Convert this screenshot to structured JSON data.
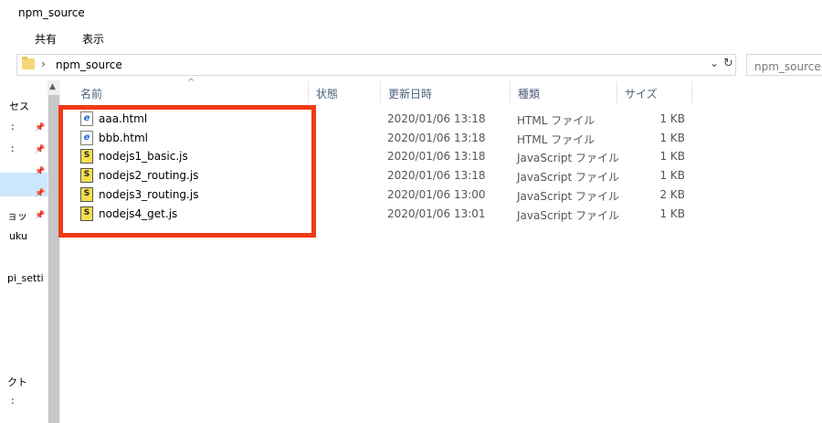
{
  "window": {
    "title": "npm_source"
  },
  "ribbon": {
    "tabs": [
      "共有",
      "表示"
    ]
  },
  "address": {
    "path": "npm_source",
    "search_placeholder": "npm_sourceの"
  },
  "nav": {
    "items": [
      {
        "label": "セス",
        "pinned": false
      },
      {
        "label": ":",
        "pinned": true
      },
      {
        "label": ":",
        "pinned": true
      },
      {
        "label": "",
        "pinned": true
      },
      {
        "label": "",
        "pinned": true
      },
      {
        "label": "ョッ",
        "pinned": true
      },
      {
        "label": "uku",
        "pinned": false
      },
      {
        "label": "pi_setti",
        "pinned": false
      },
      {
        "label": "クト",
        "pinned": false
      },
      {
        "label": ":",
        "pinned": false
      }
    ]
  },
  "columns": {
    "name": "名前",
    "status": "状態",
    "date": "更新日時",
    "type": "種類",
    "size": "サイズ"
  },
  "files": [
    {
      "icon": "html",
      "name": "aaa.html",
      "date": "2020/01/06 13:18",
      "type": "HTML ファイル",
      "size": "1 KB"
    },
    {
      "icon": "html",
      "name": "bbb.html",
      "date": "2020/01/06 13:18",
      "type": "HTML ファイル",
      "size": "1 KB"
    },
    {
      "icon": "js",
      "name": "nodejs1_basic.js",
      "date": "2020/01/06 13:18",
      "type": "JavaScript ファイル",
      "size": "1 KB"
    },
    {
      "icon": "js",
      "name": "nodejs2_routing.js",
      "date": "2020/01/06 13:18",
      "type": "JavaScript ファイル",
      "size": "1 KB"
    },
    {
      "icon": "js",
      "name": "nodejs3_routing.js",
      "date": "2020/01/06 13:00",
      "type": "JavaScript ファイル",
      "size": "2 KB"
    },
    {
      "icon": "js",
      "name": "nodejs4_get.js",
      "date": "2020/01/06 13:01",
      "type": "JavaScript ファイル",
      "size": "1 KB"
    }
  ],
  "colors": {
    "highlight": "#f03a17",
    "nav_selected": "#cce8ff",
    "header_text": "#4c607a"
  }
}
